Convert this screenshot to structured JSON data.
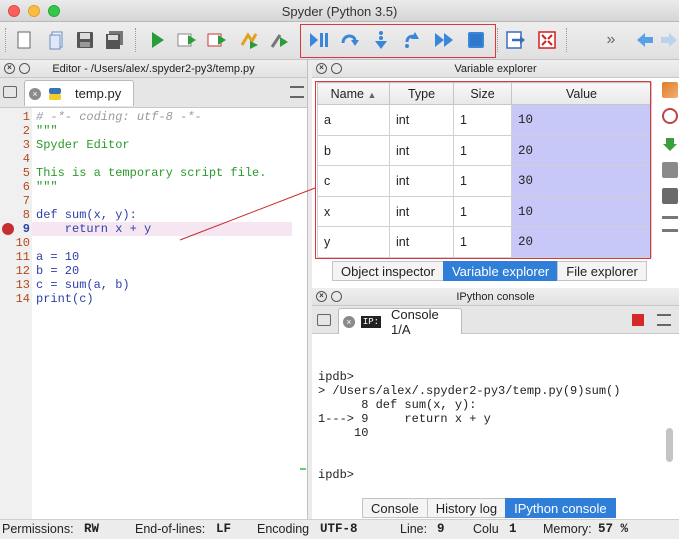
{
  "window": {
    "title": "Spyder (Python 3.5)"
  },
  "editor": {
    "header": "Editor - /Users/alex/.spyder2-py3/temp.py",
    "tab": "temp.py",
    "lines": [
      {
        "n": "1",
        "t": "# -*- coding: utf-8 -*-"
      },
      {
        "n": "2",
        "t": "\"\"\""
      },
      {
        "n": "3",
        "t": "Spyder Editor"
      },
      {
        "n": "4",
        "t": ""
      },
      {
        "n": "5",
        "t": "This is a temporary script file."
      },
      {
        "n": "6",
        "t": "\"\"\""
      },
      {
        "n": "7",
        "t": ""
      },
      {
        "n": "8",
        "t": "def sum(x, y):"
      },
      {
        "n": "9",
        "t": "    return x + y"
      },
      {
        "n": "10",
        "t": ""
      },
      {
        "n": "11",
        "t": "a = 10"
      },
      {
        "n": "12",
        "t": "b = 20"
      },
      {
        "n": "13",
        "t": "c = sum(a, b)"
      },
      {
        "n": "14",
        "t": "print(c)"
      }
    ]
  },
  "variable_explorer": {
    "header": "Variable explorer",
    "columns": [
      "Name",
      "Type",
      "Size",
      "Value"
    ],
    "rows": [
      {
        "name": "a",
        "type": "int",
        "size": "1",
        "value": "10"
      },
      {
        "name": "b",
        "type": "int",
        "size": "1",
        "value": "20"
      },
      {
        "name": "c",
        "type": "int",
        "size": "1",
        "value": "30"
      },
      {
        "name": "x",
        "type": "int",
        "size": "1",
        "value": "10"
      },
      {
        "name": "y",
        "type": "int",
        "size": "1",
        "value": "20"
      }
    ],
    "tabs": [
      "Object inspector",
      "Variable explorer",
      "File explorer"
    ]
  },
  "ipython": {
    "header": "IPython console",
    "tab": "Console 1/A",
    "tab_icon_text": "IP:",
    "lines": [
      "ipdb>",
      "> /Users/alex/.spyder2-py3/temp.py(9)sum()",
      "      8 def sum(x, y):",
      "1---> 9     return x + y",
      "     10",
      "",
      "ipdb>"
    ],
    "tabs": [
      "Console",
      "History log",
      "IPython console"
    ]
  },
  "statusbar": {
    "permissions_label": "Permissions:",
    "permissions_value": "RW",
    "eol_label": "End-of-lines:",
    "eol_value": "LF",
    "encoding_label": "Encoding",
    "encoding_value": "UTF-8",
    "line_label": "Line:",
    "line_value": "9",
    "column_label": "Colu",
    "column_value": "1",
    "memory_label": "Memory:",
    "memory_value": "57 %"
  },
  "colors": {
    "accent": "#2f7fd8",
    "highlight_box": "#d9373c",
    "value_cell": "#c8c8f8"
  }
}
